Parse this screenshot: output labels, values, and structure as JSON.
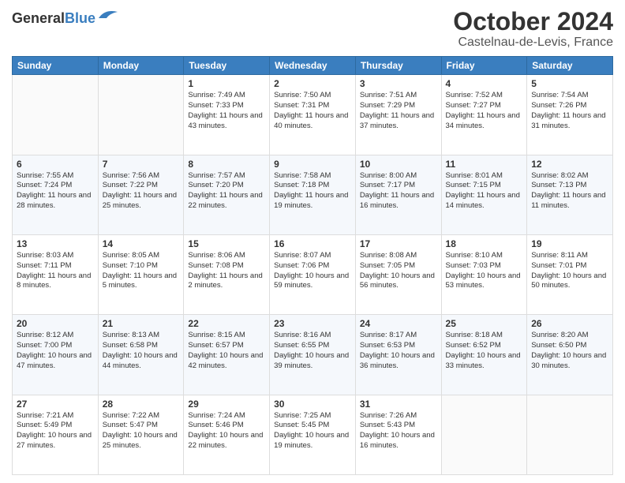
{
  "header": {
    "logo_line1": "General",
    "logo_line2": "Blue",
    "month": "October 2024",
    "location": "Castelnau-de-Levis, France"
  },
  "weekdays": [
    "Sunday",
    "Monday",
    "Tuesday",
    "Wednesday",
    "Thursday",
    "Friday",
    "Saturday"
  ],
  "weeks": [
    [
      {
        "day": "",
        "content": ""
      },
      {
        "day": "",
        "content": ""
      },
      {
        "day": "1",
        "content": "Sunrise: 7:49 AM\nSunset: 7:33 PM\nDaylight: 11 hours and 43 minutes."
      },
      {
        "day": "2",
        "content": "Sunrise: 7:50 AM\nSunset: 7:31 PM\nDaylight: 11 hours and 40 minutes."
      },
      {
        "day": "3",
        "content": "Sunrise: 7:51 AM\nSunset: 7:29 PM\nDaylight: 11 hours and 37 minutes."
      },
      {
        "day": "4",
        "content": "Sunrise: 7:52 AM\nSunset: 7:27 PM\nDaylight: 11 hours and 34 minutes."
      },
      {
        "day": "5",
        "content": "Sunrise: 7:54 AM\nSunset: 7:26 PM\nDaylight: 11 hours and 31 minutes."
      }
    ],
    [
      {
        "day": "6",
        "content": "Sunrise: 7:55 AM\nSunset: 7:24 PM\nDaylight: 11 hours and 28 minutes."
      },
      {
        "day": "7",
        "content": "Sunrise: 7:56 AM\nSunset: 7:22 PM\nDaylight: 11 hours and 25 minutes."
      },
      {
        "day": "8",
        "content": "Sunrise: 7:57 AM\nSunset: 7:20 PM\nDaylight: 11 hours and 22 minutes."
      },
      {
        "day": "9",
        "content": "Sunrise: 7:58 AM\nSunset: 7:18 PM\nDaylight: 11 hours and 19 minutes."
      },
      {
        "day": "10",
        "content": "Sunrise: 8:00 AM\nSunset: 7:17 PM\nDaylight: 11 hours and 16 minutes."
      },
      {
        "day": "11",
        "content": "Sunrise: 8:01 AM\nSunset: 7:15 PM\nDaylight: 11 hours and 14 minutes."
      },
      {
        "day": "12",
        "content": "Sunrise: 8:02 AM\nSunset: 7:13 PM\nDaylight: 11 hours and 11 minutes."
      }
    ],
    [
      {
        "day": "13",
        "content": "Sunrise: 8:03 AM\nSunset: 7:11 PM\nDaylight: 11 hours and 8 minutes."
      },
      {
        "day": "14",
        "content": "Sunrise: 8:05 AM\nSunset: 7:10 PM\nDaylight: 11 hours and 5 minutes."
      },
      {
        "day": "15",
        "content": "Sunrise: 8:06 AM\nSunset: 7:08 PM\nDaylight: 11 hours and 2 minutes."
      },
      {
        "day": "16",
        "content": "Sunrise: 8:07 AM\nSunset: 7:06 PM\nDaylight: 10 hours and 59 minutes."
      },
      {
        "day": "17",
        "content": "Sunrise: 8:08 AM\nSunset: 7:05 PM\nDaylight: 10 hours and 56 minutes."
      },
      {
        "day": "18",
        "content": "Sunrise: 8:10 AM\nSunset: 7:03 PM\nDaylight: 10 hours and 53 minutes."
      },
      {
        "day": "19",
        "content": "Sunrise: 8:11 AM\nSunset: 7:01 PM\nDaylight: 10 hours and 50 minutes."
      }
    ],
    [
      {
        "day": "20",
        "content": "Sunrise: 8:12 AM\nSunset: 7:00 PM\nDaylight: 10 hours and 47 minutes."
      },
      {
        "day": "21",
        "content": "Sunrise: 8:13 AM\nSunset: 6:58 PM\nDaylight: 10 hours and 44 minutes."
      },
      {
        "day": "22",
        "content": "Sunrise: 8:15 AM\nSunset: 6:57 PM\nDaylight: 10 hours and 42 minutes."
      },
      {
        "day": "23",
        "content": "Sunrise: 8:16 AM\nSunset: 6:55 PM\nDaylight: 10 hours and 39 minutes."
      },
      {
        "day": "24",
        "content": "Sunrise: 8:17 AM\nSunset: 6:53 PM\nDaylight: 10 hours and 36 minutes."
      },
      {
        "day": "25",
        "content": "Sunrise: 8:18 AM\nSunset: 6:52 PM\nDaylight: 10 hours and 33 minutes."
      },
      {
        "day": "26",
        "content": "Sunrise: 8:20 AM\nSunset: 6:50 PM\nDaylight: 10 hours and 30 minutes."
      }
    ],
    [
      {
        "day": "27",
        "content": "Sunrise: 7:21 AM\nSunset: 5:49 PM\nDaylight: 10 hours and 27 minutes."
      },
      {
        "day": "28",
        "content": "Sunrise: 7:22 AM\nSunset: 5:47 PM\nDaylight: 10 hours and 25 minutes."
      },
      {
        "day": "29",
        "content": "Sunrise: 7:24 AM\nSunset: 5:46 PM\nDaylight: 10 hours and 22 minutes."
      },
      {
        "day": "30",
        "content": "Sunrise: 7:25 AM\nSunset: 5:45 PM\nDaylight: 10 hours and 19 minutes."
      },
      {
        "day": "31",
        "content": "Sunrise: 7:26 AM\nSunset: 5:43 PM\nDaylight: 10 hours and 16 minutes."
      },
      {
        "day": "",
        "content": ""
      },
      {
        "day": "",
        "content": ""
      }
    ]
  ]
}
